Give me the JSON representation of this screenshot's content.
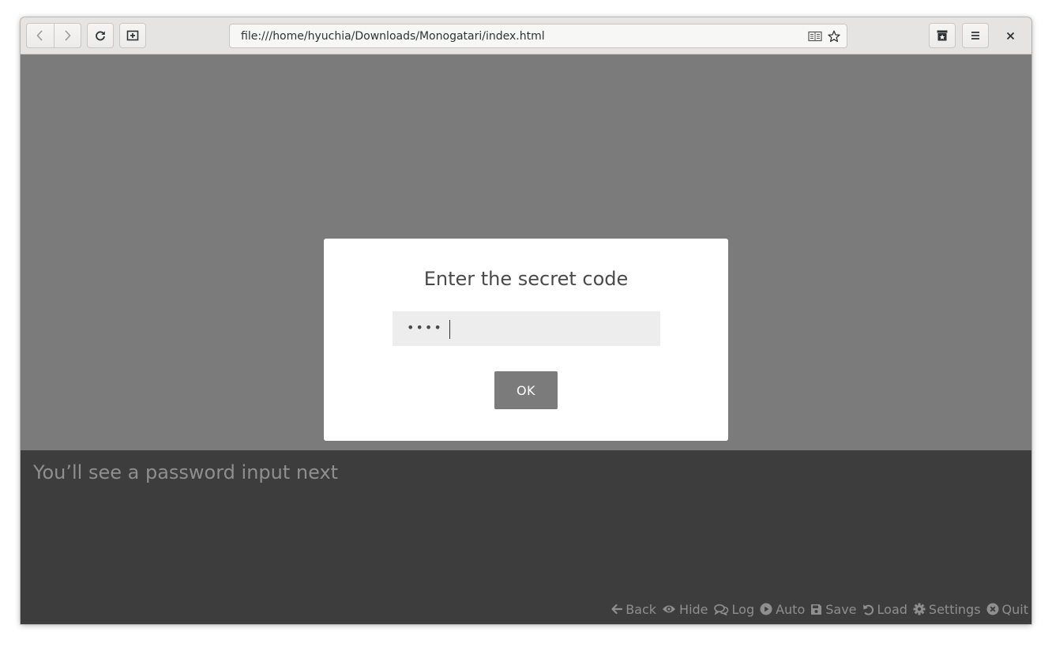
{
  "browser": {
    "url": "file:///home/hyuchia/Downloads/Monogatari/index.html",
    "icons": {
      "back": "chevron-left-icon",
      "forward": "chevron-right-icon",
      "reload": "reload-icon",
      "new_tab": "new-tab-icon",
      "reader": "reader-mode-icon",
      "bookmark": "star-icon",
      "library": "library-icon",
      "menu": "hamburger-menu-icon",
      "close": "close-icon"
    }
  },
  "modal": {
    "title": "Enter the secret code",
    "input_masked_value": "••••",
    "ok_label": "OK"
  },
  "textbox": {
    "dialog": "You’ll see a password input next"
  },
  "quick_menu": {
    "items": [
      {
        "label": "Back",
        "icon": "arrow-left-icon"
      },
      {
        "label": "Hide",
        "icon": "eye-icon"
      },
      {
        "label": "Log",
        "icon": "comments-icon"
      },
      {
        "label": "Auto",
        "icon": "play-circle-icon"
      },
      {
        "label": "Save",
        "icon": "save-icon"
      },
      {
        "label": "Load",
        "icon": "undo-icon"
      },
      {
        "label": "Settings",
        "icon": "gear-icon"
      },
      {
        "label": "Quit",
        "icon": "times-circle-icon"
      }
    ]
  },
  "colors": {
    "stage": "#7b7b7b",
    "textbox": "#3d3d3d",
    "modal": "#ffffff",
    "button": "#7b7b7b",
    "muted_text": "#8f8f8f"
  }
}
